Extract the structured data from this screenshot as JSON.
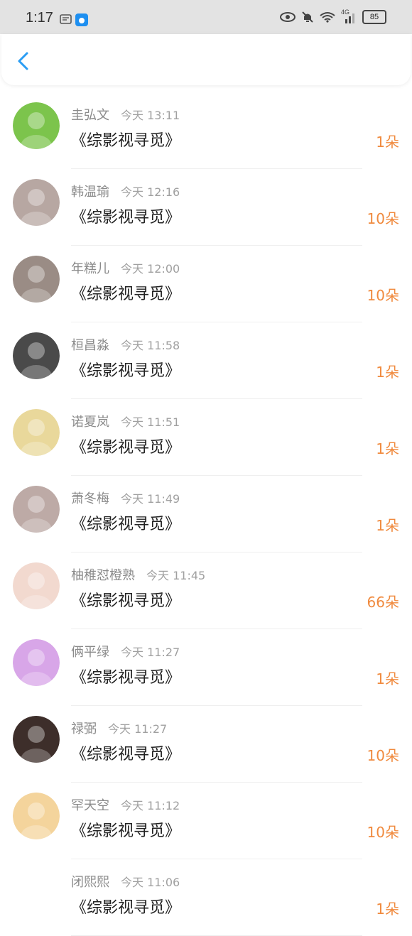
{
  "status_bar": {
    "time": "1:17",
    "battery": "85",
    "network": "4G",
    "icons": [
      "message-icon",
      "app-notification-icon",
      "eye-icon",
      "mute-bell-icon",
      "wifi-icon",
      "signal-icon",
      "battery-icon"
    ]
  },
  "header": {
    "back_icon": "chevron-left-icon"
  },
  "accent_color": "#f08a3e",
  "list": {
    "items": [
      {
        "name": "圭弘文",
        "time": "今天 13:11",
        "title": "《综影视寻觅》",
        "amount": "1朵",
        "avatar": "butterfly-avatar",
        "avatar_color": "#7cc44c"
      },
      {
        "name": "韩温瑜",
        "time": "今天 12:16",
        "title": "《综影视寻觅》",
        "amount": "10朵",
        "avatar": "couple-photo-avatar",
        "avatar_color": "#b7a7a2"
      },
      {
        "name": "年糕儿",
        "time": "今天 12:00",
        "title": "《综影视寻觅》",
        "amount": "10朵",
        "avatar": "costume-girl-avatar",
        "avatar_color": "#9a8c85"
      },
      {
        "name": "桓昌淼",
        "time": "今天 11:58",
        "title": "《综影视寻觅》",
        "amount": "1朵",
        "avatar": "anime-duo-avatar",
        "avatar_color": "#4a4a4a"
      },
      {
        "name": "诺夏岚",
        "time": "今天 11:51",
        "title": "《综影视寻觅》",
        "amount": "1朵",
        "avatar": "roses-avatar",
        "avatar_color": "#e9d89b"
      },
      {
        "name": "萧冬梅",
        "time": "今天 11:49",
        "title": "《综影视寻觅》",
        "amount": "1朵",
        "avatar": "blurred-girl-avatar",
        "avatar_color": "#bdaaa6"
      },
      {
        "name": "柚稚怼橙熟",
        "time": "今天 11:45",
        "title": "《综影视寻觅》",
        "amount": "66朵",
        "avatar": "anime-girl-avatar",
        "avatar_color": "#f2d9cf"
      },
      {
        "name": "俩平绿",
        "time": "今天 11:27",
        "title": "《综影视寻觅》",
        "amount": "1朵",
        "avatar": "purple-girl-avatar",
        "avatar_color": "#d8a6e8"
      },
      {
        "name": "禄弼",
        "time": "今天 11:27",
        "title": "《综影视寻觅》",
        "amount": "10朵",
        "avatar": "dark-anime-avatar",
        "avatar_color": "#3d2e2a"
      },
      {
        "name": "罕天空",
        "time": "今天 11:12",
        "title": "《综影视寻觅》",
        "amount": "10朵",
        "avatar": "pastel-anime-avatar",
        "avatar_color": "#f4d49c"
      },
      {
        "name": "闭熙熙",
        "time": "今天 11:06",
        "title": "《综影视寻觅》",
        "amount": "1朵",
        "avatar": "qq-penguin-avatar",
        "avatar_color": "#ffffff"
      }
    ]
  }
}
